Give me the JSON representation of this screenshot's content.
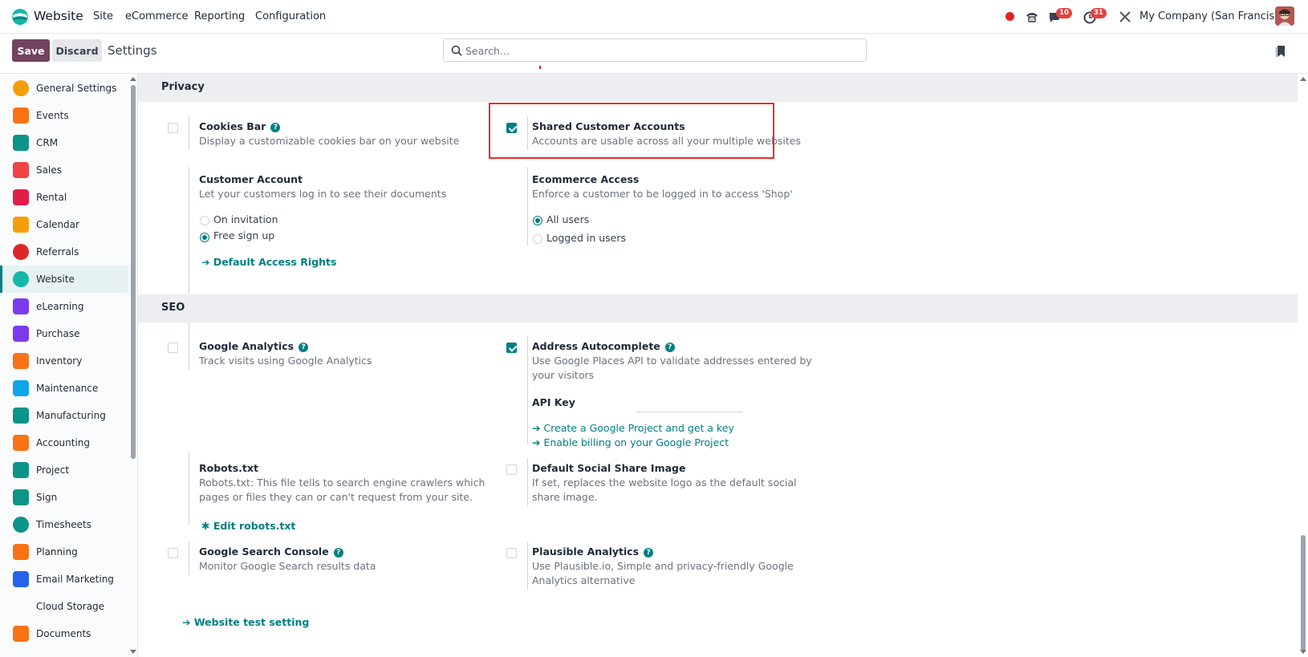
{
  "navbar": {
    "app_name": "Website",
    "menus": [
      "Site",
      "eCommerce",
      "Reporting",
      "Configuration"
    ],
    "messages_badge": "10",
    "activities_badge": "31",
    "company": "My Company (San Francisco)"
  },
  "control_panel": {
    "save_label": "Save",
    "discard_label": "Discard",
    "title": "Settings",
    "search_placeholder": "Search..."
  },
  "sidebar": {
    "items": [
      {
        "label": "General Settings",
        "icon": "general-settings-icon",
        "color": "#f59e0b"
      },
      {
        "label": "Events",
        "icon": "events-icon",
        "color": "#f97316"
      },
      {
        "label": "CRM",
        "icon": "crm-icon",
        "color": "#0d9488"
      },
      {
        "label": "Sales",
        "icon": "sales-icon",
        "color": "#ef4444"
      },
      {
        "label": "Rental",
        "icon": "rental-icon",
        "color": "#e11d48"
      },
      {
        "label": "Calendar",
        "icon": "calendar-icon",
        "color": "#f59e0b"
      },
      {
        "label": "Referrals",
        "icon": "referrals-icon",
        "color": "#dc2626"
      },
      {
        "label": "Website",
        "icon": "website-icon",
        "color": "#14b8a6"
      },
      {
        "label": "eLearning",
        "icon": "elearning-icon",
        "color": "#7c3aed"
      },
      {
        "label": "Purchase",
        "icon": "purchase-icon",
        "color": "#7c3aed"
      },
      {
        "label": "Inventory",
        "icon": "inventory-icon",
        "color": "#f97316"
      },
      {
        "label": "Maintenance",
        "icon": "maintenance-icon",
        "color": "#0ea5e9"
      },
      {
        "label": "Manufacturing",
        "icon": "manufacturing-icon",
        "color": "#0d9488"
      },
      {
        "label": "Accounting",
        "icon": "accounting-icon",
        "color": "#f97316"
      },
      {
        "label": "Project",
        "icon": "project-icon",
        "color": "#0d9488"
      },
      {
        "label": "Sign",
        "icon": "sign-icon",
        "color": "#0d9488"
      },
      {
        "label": "Timesheets",
        "icon": "timesheets-icon",
        "color": "#0d9488"
      },
      {
        "label": "Planning",
        "icon": "planning-icon",
        "color": "#f97316"
      },
      {
        "label": "Email Marketing",
        "icon": "email-marketing-icon",
        "color": "#2563eb"
      },
      {
        "label": "Cloud Storage",
        "icon": "",
        "color": ""
      },
      {
        "label": "Documents",
        "icon": "documents-icon",
        "color": "#f97316"
      }
    ],
    "active": "Website"
  },
  "privacy": {
    "heading": "Privacy",
    "cookies_bar": {
      "title": "Cookies Bar",
      "desc": "Display a customizable cookies bar on your website",
      "checked": false
    },
    "shared_accounts": {
      "title": "Shared Customer Accounts",
      "desc": "Accounts are usable across all your multiple websites",
      "checked": true
    },
    "customer_account": {
      "title": "Customer Account",
      "desc": "Let your customers log in to see their documents",
      "options": [
        "On invitation",
        "Free sign up"
      ],
      "selected": "Free sign up",
      "link": "Default Access Rights"
    },
    "ecommerce_access": {
      "title": "Ecommerce Access",
      "desc": "Enforce a customer to be logged in to access 'Shop'",
      "options": [
        "All users",
        "Logged in users"
      ],
      "selected": "All users"
    }
  },
  "seo": {
    "heading": "SEO",
    "google_analytics": {
      "title": "Google Analytics",
      "desc": "Track visits using Google Analytics",
      "checked": false
    },
    "address_autocomplete": {
      "title": "Address Autocomplete",
      "desc": "Use Google Places API to validate addresses entered by your visitors",
      "checked": true,
      "api_key_label": "API Key",
      "api_key_value": "",
      "link1": "Create a Google Project and get a key",
      "link2": "Enable billing on your Google Project"
    },
    "robots": {
      "title": "Robots.txt",
      "desc": "Robots.txt: This file tells to search engine crawlers which pages or files they can or can't request from your site.",
      "link": "Edit robots.txt"
    },
    "social_image": {
      "title": "Default Social Share Image",
      "desc": "If set, replaces the website logo as the default social share image.",
      "checked": false
    },
    "search_console": {
      "title": "Google Search Console",
      "desc": "Monitor Google Search results data",
      "checked": false
    },
    "plausible": {
      "title": "Plausible Analytics",
      "desc": "Use Plausible.io, Simple and privacy-friendly Google Analytics alternative",
      "checked": false
    },
    "test_link": "Website test setting"
  },
  "colors": {
    "accent": "#017e84",
    "brand": "#71435f",
    "highlight": "#e0312c"
  }
}
